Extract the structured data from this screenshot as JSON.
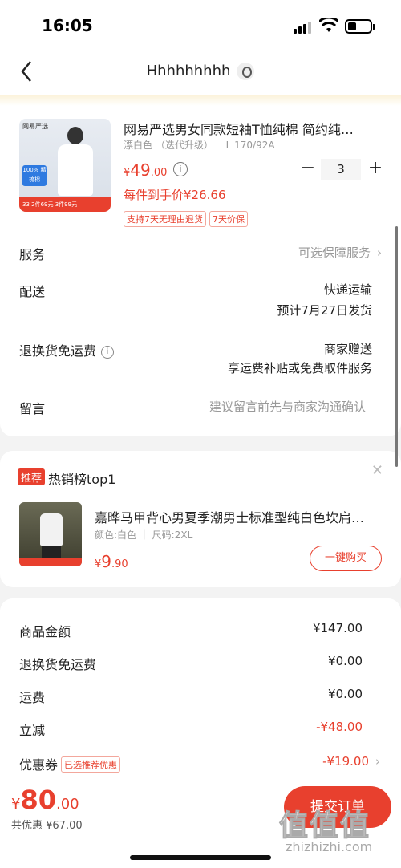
{
  "status_bar": {
    "time": "16:05"
  },
  "nav": {
    "title": "Hhhhhhhhh"
  },
  "product": {
    "title": "网易严选男女同款短袖T恤纯棉 简约纯…",
    "spec": "漂白色 （迭代升级） ｜L 170/92A",
    "price_symbol": "¥",
    "price_int": "49",
    "price_dec": ".00",
    "quantity": "3",
    "unit_price": "每件到手价¥26.66",
    "tags": [
      "支持7天无理由退货",
      "7天价保"
    ],
    "thumb": {
      "brand": "网易严选",
      "badge": "100% 精梳棉",
      "promo": "33 2件69元 3件99元"
    }
  },
  "rows": {
    "service_label": "服务",
    "service_value": "可选保障服务",
    "delivery_label": "配送",
    "delivery_value1": "快递运输",
    "delivery_value2": "预计7月27日发货",
    "return_label": "退换货免运费",
    "return_value1": "商家赠送",
    "return_value2": "享运费补贴或免费取件服务",
    "note_label": "留言",
    "note_placeholder": "建议留言前先与商家沟通确认"
  },
  "recommend": {
    "badge": "推荐",
    "title": "热销榜top1",
    "name": "嘉晔马甲背心男夏季潮男士标准型纯白色坎肩…",
    "spec": "颜色:白色 ｜ 尺码:2XL",
    "price_symbol": "¥",
    "price_int": "9",
    "price_dec": ".90",
    "buy_label": "一键购买"
  },
  "summary": {
    "goods_label": "商品金额",
    "goods_value": "¥147.00",
    "return_label": "退换货免运费",
    "return_value": "¥0.00",
    "shipping_label": "运费",
    "shipping_value": "¥0.00",
    "instant_label": "立减",
    "instant_value": "-¥48.00",
    "coupon_label": "优惠券",
    "coupon_tag": "已选推荐优惠",
    "coupon_value": "-¥19.00"
  },
  "bottom": {
    "total_symbol": "¥",
    "total_int": "80",
    "total_dec": ".00",
    "discount": "共优惠 ¥67.00",
    "submit_label": "提交订单"
  },
  "watermark": {
    "text": "值值值",
    "sub": "zhizhizhi.com"
  },
  "colors": {
    "accent": "#e8402e"
  }
}
